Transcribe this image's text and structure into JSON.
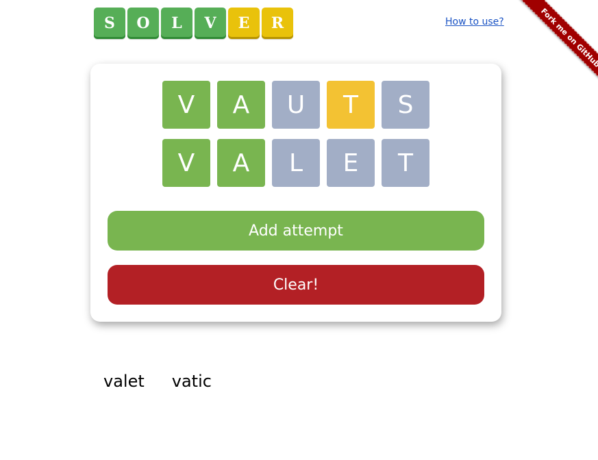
{
  "logo": {
    "tiles": [
      {
        "letter": "S",
        "color": "#56ae57"
      },
      {
        "letter": "O",
        "color": "#56ae57"
      },
      {
        "letter": "L",
        "color": "#56ae57"
      },
      {
        "letter": "V",
        "color": "#56ae57"
      },
      {
        "letter": "E",
        "color": "#e9c20b"
      },
      {
        "letter": "R",
        "color": "#e9c20b"
      }
    ]
  },
  "header": {
    "howto_label": "How to use?"
  },
  "ribbon": {
    "label": "Fork me on GitHub",
    "color": "#a00000"
  },
  "attempts": [
    [
      {
        "letter": "V",
        "state": "green"
      },
      {
        "letter": "A",
        "state": "green"
      },
      {
        "letter": "U",
        "state": "gray"
      },
      {
        "letter": "T",
        "state": "yellow"
      },
      {
        "letter": "S",
        "state": "gray"
      }
    ],
    [
      {
        "letter": "V",
        "state": "green"
      },
      {
        "letter": "A",
        "state": "green"
      },
      {
        "letter": "L",
        "state": "gray"
      },
      {
        "letter": "E",
        "state": "gray"
      },
      {
        "letter": "T",
        "state": "gray"
      }
    ]
  ],
  "buttons": {
    "add_label": "Add attempt",
    "clear_label": "Clear!"
  },
  "results": [
    "valet",
    "vatic"
  ],
  "colors": {
    "green": "#79b550",
    "yellow": "#f3c233",
    "gray": "#a2aec6",
    "red": "#b32025"
  }
}
